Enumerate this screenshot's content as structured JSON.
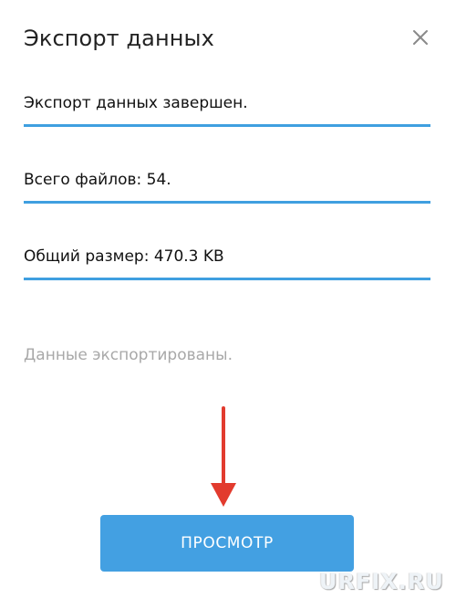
{
  "dialog": {
    "title": "Экспорт данных",
    "close_icon": "close-icon",
    "status_lines": [
      "Экспорт данных завершен.",
      "Всего файлов: 54.",
      "Общий размер: 470.3 KB"
    ],
    "hint": "Данные экспортированы.",
    "view_button_label": "ПРОСМОТР"
  },
  "annotation": {
    "arrow_icon": "arrow-down-icon",
    "arrow_color": "#e23b2e"
  },
  "watermark": {
    "text": "URFIX.RU"
  },
  "colors": {
    "accent": "#43a0e2",
    "underline": "#3f9fe0",
    "hint": "#a8a8a8"
  }
}
